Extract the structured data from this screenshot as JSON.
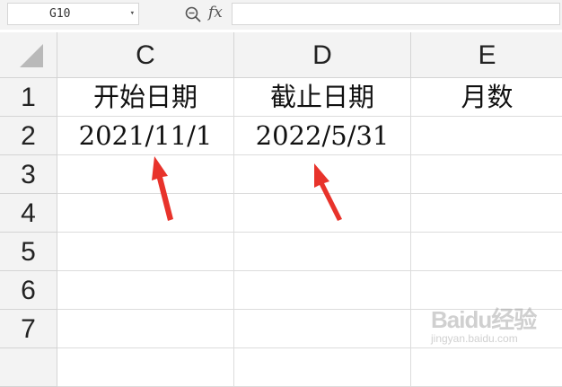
{
  "formula_bar": {
    "name_box_value": "G10",
    "formula_value": "",
    "fx_label": "fx"
  },
  "columns": [
    "C",
    "D",
    "E"
  ],
  "rows": [
    "1",
    "2",
    "3",
    "4",
    "5",
    "6",
    "7"
  ],
  "cells": {
    "C1": "开始日期",
    "D1": "截止日期",
    "E1": "月数",
    "C2": "2021/11/1",
    "D2": "2022/5/31",
    "E2": ""
  },
  "watermark": {
    "brand": "Baidu经验",
    "url": "jingyan.baidu.com"
  },
  "colors": {
    "arrow": "#e8332b",
    "header_bg": "#f3f3f3",
    "gridline": "#dcdcdc"
  }
}
